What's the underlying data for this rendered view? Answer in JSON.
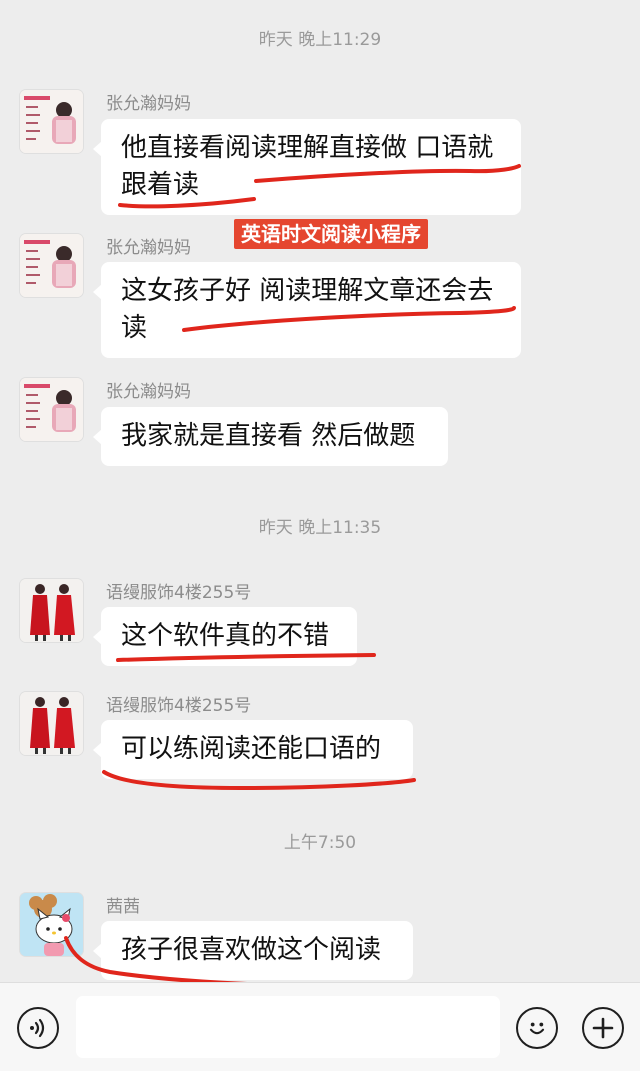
{
  "timestamps": [
    "昨天 晚上11:29",
    "昨天 晚上11:35",
    "上午7:50"
  ],
  "overlay_label": "英语时文阅读小程序",
  "messages": [
    {
      "sender": "张允瀚妈妈",
      "text": "他直接看阅读理解直接做 口语就跟着读"
    },
    {
      "sender": "张允瀚妈妈",
      "text": "这女孩子好 阅读理解文章还会去读"
    },
    {
      "sender": "张允瀚妈妈",
      "text": "我家就是直接看 然后做题"
    },
    {
      "sender": "语缦服饰4楼255号",
      "text": "这个软件真的不错"
    },
    {
      "sender": "语缦服饰4楼255号",
      "text": "可以练阅读还能口语的"
    },
    {
      "sender": "茜茜",
      "text": "孩子很喜欢做这个阅读"
    }
  ],
  "input_bar": {
    "placeholder": "",
    "voice_icon": "voice-icon",
    "emoji_icon": "emoji-icon",
    "plus_icon": "plus-icon"
  },
  "colors": {
    "background": "#ededed",
    "bubble": "#ffffff",
    "annotation_red": "#e0261c",
    "label_red": "#e5462f"
  }
}
